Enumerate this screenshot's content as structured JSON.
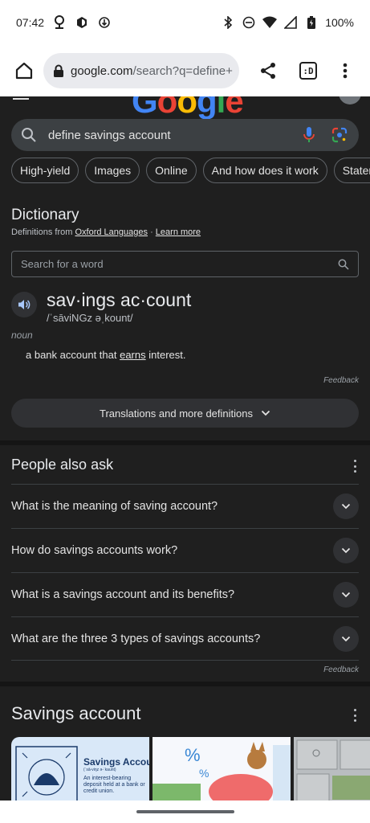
{
  "status_bar": {
    "time": "07:42",
    "battery": "100%",
    "icons": [
      "location-icon",
      "settings-icon",
      "data-saver-icon",
      "bluetooth-icon",
      "dnd-icon",
      "wifi-icon",
      "signal-icon",
      "battery-icon"
    ]
  },
  "browser": {
    "url_host": "google.com",
    "url_path": "/search?q=define+",
    "tab_label": ":D"
  },
  "search": {
    "query": "define savings account"
  },
  "chips": [
    "High-yield",
    "Images",
    "Online",
    "And how does it work",
    "Statement"
  ],
  "dictionary": {
    "title": "Dictionary",
    "from_prefix": "Definitions from",
    "source": "Oxford Languages",
    "separator": "·",
    "learn_more": "Learn more",
    "search_placeholder": "Search for a word",
    "headword": "sav·ings ac·count",
    "phonetic": "/ˈsāviNGz əˌkount/",
    "part_of_speech": "noun",
    "definition_before": "a bank account that ",
    "definition_link": "earns",
    "definition_after": " interest.",
    "feedback": "Feedback",
    "more_button": "Translations and more definitions"
  },
  "people_also_ask": {
    "title": "People also ask",
    "questions": [
      "What is the meaning of saving account?",
      "How do savings accounts work?",
      "What is a savings account and its benefits?",
      "What are the three 3 types of savings accounts?"
    ],
    "feedback": "Feedback"
  },
  "savings_section": {
    "title": "Savings account",
    "thumb1_title": "Savings Accoun",
    "thumb1_phonetic": "(ˈsā-viŋz ə-ˈkaunt)",
    "thumb1_desc": "An interest-bearing deposit held at a bank or credit union."
  }
}
